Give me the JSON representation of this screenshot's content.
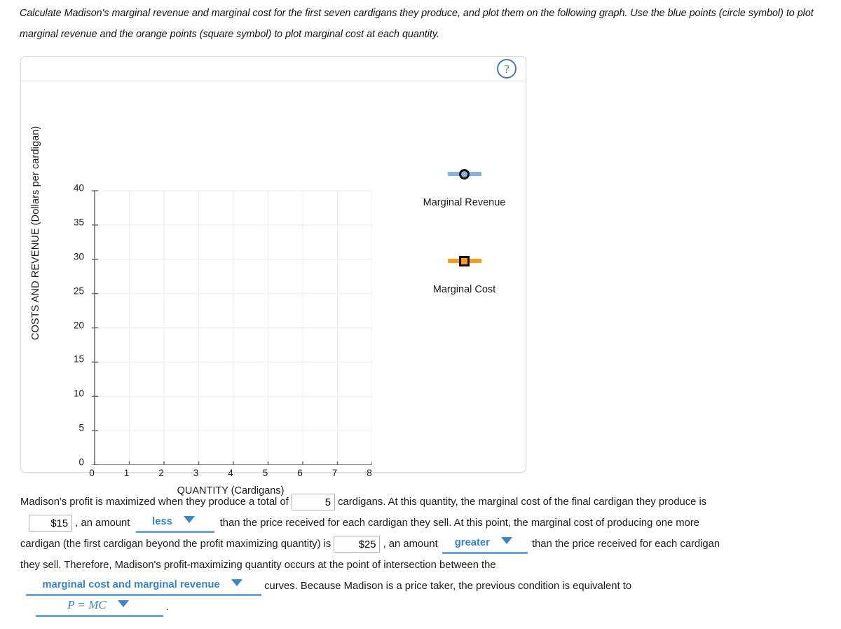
{
  "prompt": "Calculate Madison's marginal revenue and marginal cost for the first seven cardigans they produce, and plot them on the following graph. Use the blue points (circle symbol) to plot marginal revenue and the orange points (square symbol) to plot marginal cost at each quantity.",
  "panel": {
    "help_label": "?"
  },
  "chart_data": {
    "type": "scatter",
    "title": "",
    "xlabel": "QUANTITY (Cardigans)",
    "ylabel": "COSTS AND REVENUE (Dollars per cardigan)",
    "xlim": [
      0,
      8
    ],
    "ylim": [
      0,
      40
    ],
    "xticks": [
      0,
      1,
      2,
      3,
      4,
      5,
      6,
      7,
      8
    ],
    "yticks": [
      0,
      5,
      10,
      15,
      20,
      25,
      30,
      35,
      40
    ],
    "grid": true,
    "legend_position": "right",
    "series": [
      {
        "name": "Marginal Revenue",
        "marker": "circle",
        "color": "#8ab4dc",
        "edge_color": "#111111",
        "x": [],
        "y": []
      },
      {
        "name": "Marginal Cost",
        "marker": "square",
        "color": "#f79d1e",
        "edge_color": "#111111",
        "x": [],
        "y": []
      }
    ]
  },
  "legend": {
    "entries": [
      {
        "label": "Marginal Revenue",
        "marker": "circle",
        "line_color": "#8ab4dc",
        "fill_color": "#8ab4dc"
      },
      {
        "label": "Marginal Cost",
        "marker": "square",
        "line_color": "#f89c1c",
        "fill_color": "#f89c1c"
      }
    ]
  },
  "answer": {
    "line1_a": "Madison's profit is maximized when they produce a total of",
    "quantity_value": "5",
    "line1_b": "cardigans. At this quantity, the marginal cost of the final cardigan they produce is",
    "mc_final_value": "$15",
    "line2_a": ", an amount",
    "less_more_value": "less",
    "line2_b": "than the price received for each cardigan they sell. At this point, the marginal cost of producing one more",
    "line3_a": "cardigan (the first cardigan beyond the profit maximizing quantity) is",
    "mc_next_value": "$25",
    "line3_b": ", an amount",
    "greater_value": "greater",
    "line3_c": "than the price received for each cardigan",
    "line4": "they sell. Therefore, Madison's profit-maximizing quantity occurs at the point of intersection between the",
    "curves_value": "marginal cost and marginal revenue",
    "line5_b": "curves. Because Madison is a price taker, the previous condition is equivalent to",
    "condition_value": "P = MC",
    "line6_end": "."
  }
}
